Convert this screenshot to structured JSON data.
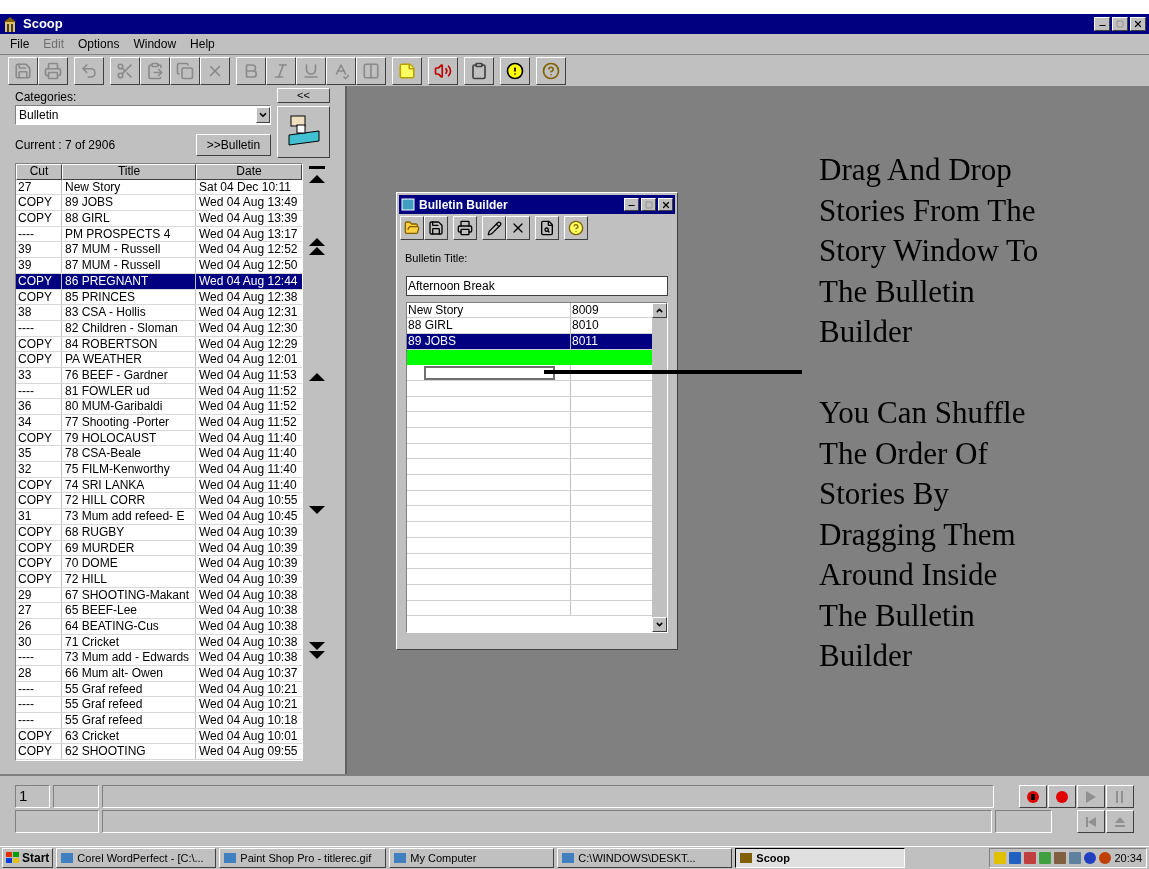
{
  "window": {
    "title": "Scoop"
  },
  "menu": [
    {
      "label": "File",
      "disabled": false
    },
    {
      "label": "Edit",
      "disabled": true
    },
    {
      "label": "Options",
      "disabled": false
    },
    {
      "label": "Window",
      "disabled": false
    },
    {
      "label": "Help",
      "disabled": false
    }
  ],
  "toolbar": [
    [
      {
        "kind": "save",
        "disabled": true
      },
      {
        "kind": "print",
        "disabled": true
      }
    ],
    [
      {
        "kind": "undo",
        "disabled": true
      }
    ],
    [
      {
        "kind": "cut",
        "disabled": true
      },
      {
        "kind": "paste",
        "disabled": true
      },
      {
        "kind": "copy",
        "disabled": true
      },
      {
        "kind": "delete",
        "disabled": true
      }
    ],
    [
      {
        "kind": "bold",
        "disabled": true
      },
      {
        "kind": "italic",
        "disabled": true
      },
      {
        "kind": "underline",
        "disabled": true
      },
      {
        "kind": "spell",
        "disabled": true
      },
      {
        "kind": "columns",
        "disabled": true
      }
    ],
    [
      {
        "kind": "note",
        "disabled": false
      }
    ],
    [
      {
        "kind": "speaker",
        "disabled": false
      }
    ],
    [
      {
        "kind": "clipboard",
        "disabled": false
      }
    ],
    [
      {
        "kind": "alert",
        "disabled": false
      }
    ],
    [
      {
        "kind": "help",
        "disabled": false
      }
    ]
  ],
  "sidebar": {
    "categories_label": "Categories:",
    "collapse_button": "<<",
    "category": "Bulletin",
    "current": "Current : 7 of 2906",
    "send_button": ">>Bulletin"
  },
  "stories": {
    "columns": [
      "Cut",
      "Title",
      "Date"
    ],
    "rows": [
      {
        "cut": "27",
        "title": "New Story",
        "date": "Sat 04 Dec 10:11",
        "selected": false
      },
      {
        "cut": "COPY",
        "title": "89 JOBS",
        "date": "Wed 04 Aug 13:49",
        "selected": false
      },
      {
        "cut": "COPY",
        "title": "88 GIRL",
        "date": "Wed 04 Aug 13:39",
        "selected": false
      },
      {
        "cut": "----",
        "title": "PM PROSPECTS 4",
        "date": "Wed 04 Aug 13:17",
        "selected": false
      },
      {
        "cut": "39",
        "title": "87 MUM - Russell",
        "date": "Wed 04 Aug 12:52",
        "selected": false
      },
      {
        "cut": "39",
        "title": "87 MUM - Russell",
        "date": "Wed 04 Aug 12:50",
        "selected": false
      },
      {
        "cut": "COPY",
        "title": "86 PREGNANT",
        "date": "Wed 04 Aug 12:44",
        "selected": true
      },
      {
        "cut": "COPY",
        "title": "85 PRINCES",
        "date": "Wed 04 Aug 12:38",
        "selected": false
      },
      {
        "cut": "38",
        "title": "83 CSA - Hollis",
        "date": "Wed 04 Aug 12:31",
        "selected": false
      },
      {
        "cut": "----",
        "title": "82 Children - Sloman",
        "date": "Wed 04 Aug 12:30",
        "selected": false
      },
      {
        "cut": "COPY",
        "title": "84 ROBERTSON",
        "date": "Wed 04 Aug 12:29",
        "selected": false
      },
      {
        "cut": "COPY",
        "title": "PA WEATHER",
        "date": "Wed 04 Aug 12:01",
        "selected": false
      },
      {
        "cut": "33",
        "title": "76 BEEF - Gardner",
        "date": "Wed 04 Aug 11:53",
        "selected": false
      },
      {
        "cut": "----",
        "title": "81 FOWLER ud",
        "date": "Wed 04 Aug 11:52",
        "selected": false
      },
      {
        "cut": "36",
        "title": "80 MUM-Garibaldi",
        "date": "Wed 04 Aug 11:52",
        "selected": false
      },
      {
        "cut": "34",
        "title": "77 Shooting -Porter",
        "date": "Wed 04 Aug 11:52",
        "selected": false
      },
      {
        "cut": "COPY",
        "title": "79 HOLOCAUST",
        "date": "Wed 04 Aug 11:40",
        "selected": false
      },
      {
        "cut": "35",
        "title": "78 CSA-Beale",
        "date": "Wed 04 Aug 11:40",
        "selected": false
      },
      {
        "cut": "32",
        "title": "75 FILM-Kenworthy",
        "date": "Wed 04 Aug 11:40",
        "selected": false
      },
      {
        "cut": "COPY",
        "title": "74 SRI LANKA",
        "date": "Wed 04 Aug 11:40",
        "selected": false
      },
      {
        "cut": "COPY",
        "title": "72 HILL CORR",
        "date": "Wed 04 Aug 10:55",
        "selected": false
      },
      {
        "cut": "31",
        "title": "73 Mum add refeed- E",
        "date": "Wed 04 Aug 10:45",
        "selected": false
      },
      {
        "cut": "COPY",
        "title": "68 RUGBY",
        "date": "Wed 04 Aug 10:39",
        "selected": false
      },
      {
        "cut": "COPY",
        "title": "69 MURDER",
        "date": "Wed 04 Aug 10:39",
        "selected": false
      },
      {
        "cut": "COPY",
        "title": "70 DOME",
        "date": "Wed 04 Aug 10:39",
        "selected": false
      },
      {
        "cut": "COPY",
        "title": "72 HILL",
        "date": "Wed 04 Aug 10:39",
        "selected": false
      },
      {
        "cut": "29",
        "title": "67 SHOOTING-Makant",
        "date": "Wed 04 Aug 10:38",
        "selected": false
      },
      {
        "cut": "27",
        "title": "65 BEEF-Lee",
        "date": "Wed 04 Aug 10:38",
        "selected": false
      },
      {
        "cut": "26",
        "title": "64 BEATING-Cus",
        "date": "Wed 04 Aug 10:38",
        "selected": false
      },
      {
        "cut": "30",
        "title": "71 Cricket",
        "date": "Wed 04 Aug 10:38",
        "selected": false
      },
      {
        "cut": "----",
        "title": "73 Mum add - Edwards",
        "date": "Wed 04 Aug 10:38",
        "selected": false
      },
      {
        "cut": "28",
        "title": "66 Mum alt- Owen",
        "date": "Wed 04 Aug 10:37",
        "selected": false
      },
      {
        "cut": "----",
        "title": "55 Graf refeed",
        "date": "Wed 04 Aug 10:21",
        "selected": false
      },
      {
        "cut": "----",
        "title": "55 Graf refeed",
        "date": "Wed 04 Aug 10:21",
        "selected": false
      },
      {
        "cut": "----",
        "title": "55 Graf refeed",
        "date": "Wed 04 Aug 10:18",
        "selected": false
      },
      {
        "cut": "COPY",
        "title": "63 Cricket",
        "date": "Wed 04 Aug 10:01",
        "selected": false
      },
      {
        "cut": "COPY",
        "title": "62 SHOOTING",
        "date": "Wed 04 Aug 09:55",
        "selected": false
      }
    ]
  },
  "bulletin_builder": {
    "title": "Bulletin Builder",
    "title_label": "Bulletin Title:",
    "bulletin_title": "Afternoon Break",
    "drop_target": true,
    "rows": [
      {
        "title": "New Story",
        "number": "8009",
        "selected": false
      },
      {
        "title": "88 GIRL",
        "number": "8010",
        "selected": false
      },
      {
        "title": "89 JOBS",
        "number": "8011",
        "selected": true
      }
    ]
  },
  "annotations": [
    {
      "lines": [
        "Drag And Drop",
        "Stories From The",
        "Story Window To",
        "The Bulletin",
        "Builder"
      ]
    },
    {
      "lines": [
        "You Can Shuffle",
        "The Order Of",
        "Stories By",
        "Dragging Them",
        "Around Inside",
        "The Bulletin",
        "Builder"
      ]
    }
  ],
  "player": {
    "counter": "1"
  },
  "taskbar": {
    "start": "Start",
    "tasks": [
      {
        "label": "Corel WordPerfect - [C:\\...",
        "selected": false
      },
      {
        "label": "Paint Shop Pro - titlerec.gif",
        "selected": false
      },
      {
        "label": "My Computer",
        "selected": false
      },
      {
        "label": "C:\\WINDOWS\\DESKT...",
        "selected": false
      },
      {
        "label": "Scoop",
        "selected": true
      }
    ],
    "clock": "20:34"
  }
}
